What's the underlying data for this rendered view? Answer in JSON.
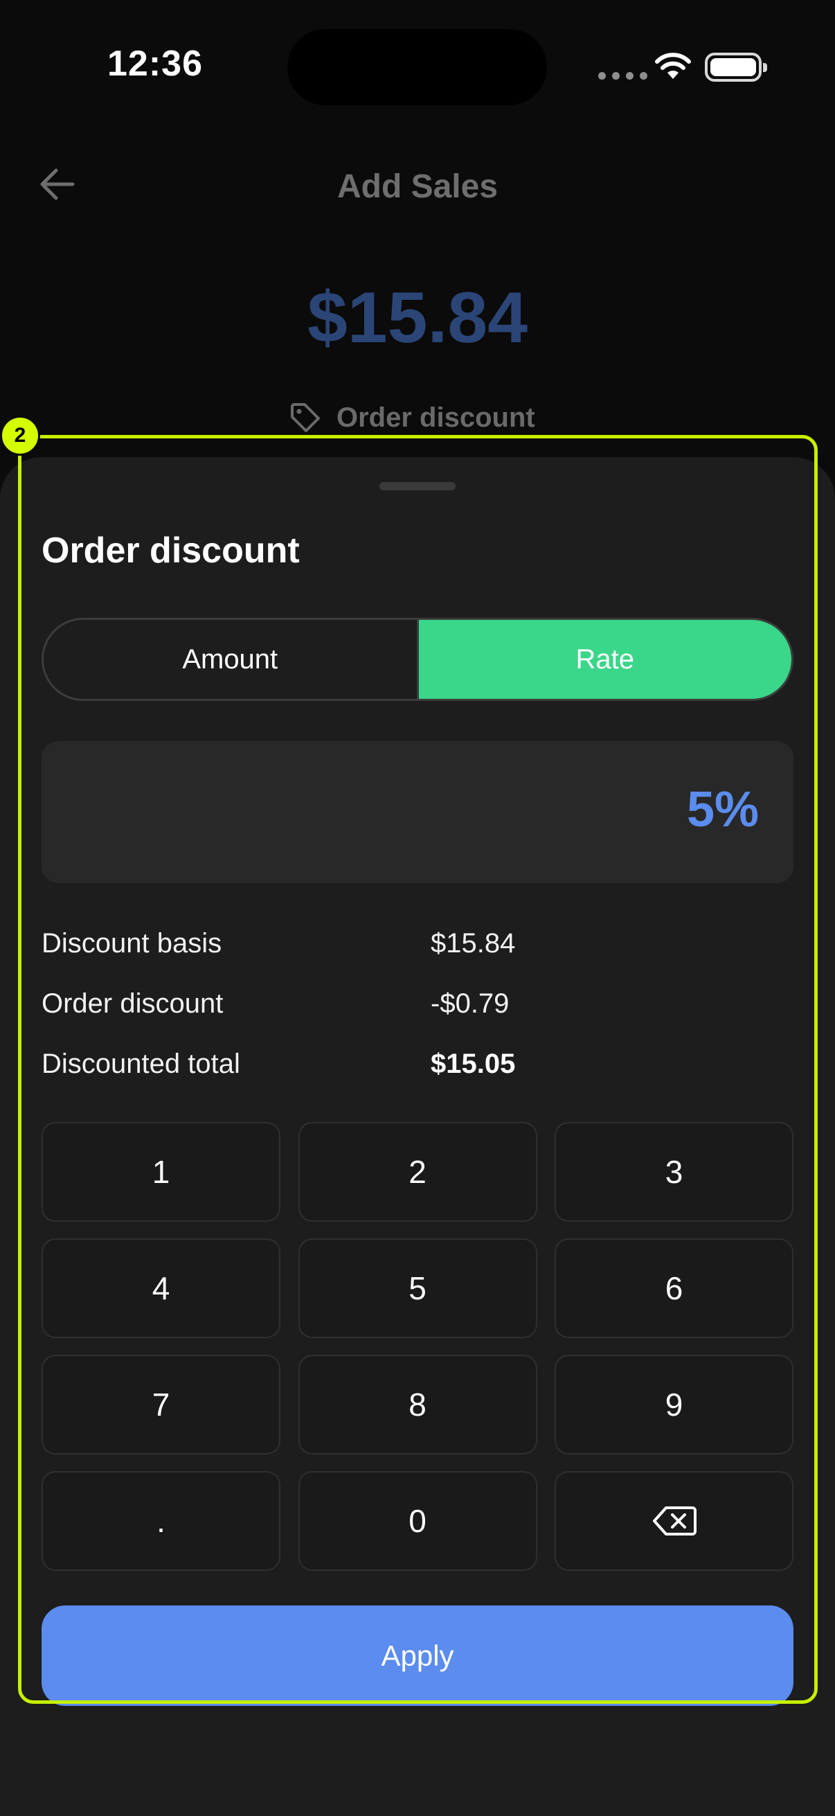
{
  "status_bar": {
    "time": "12:36"
  },
  "header": {
    "title": "Add Sales",
    "amount": "$15.84",
    "discount_label": "Order discount"
  },
  "sheet": {
    "title": "Order discount",
    "tabs": [
      {
        "label": "Amount",
        "selected": false
      },
      {
        "label": "Rate",
        "selected": true
      }
    ],
    "value": "5%",
    "summary": [
      {
        "label": "Discount basis",
        "value": "$15.84"
      },
      {
        "label": "Order discount",
        "value": "-$0.79"
      },
      {
        "label": "Discounted total",
        "value": "$15.05"
      }
    ],
    "keypad": [
      "1",
      "2",
      "3",
      "4",
      "5",
      "6",
      "7",
      "8",
      "9",
      ".",
      "0"
    ],
    "backspace_icon": "backspace-icon",
    "apply_label": "Apply"
  },
  "annotation": {
    "badge": "2"
  },
  "colors": {
    "accent_green": "#3ad689",
    "accent_blue": "#5b8cee",
    "highlight": "#c6f000"
  }
}
